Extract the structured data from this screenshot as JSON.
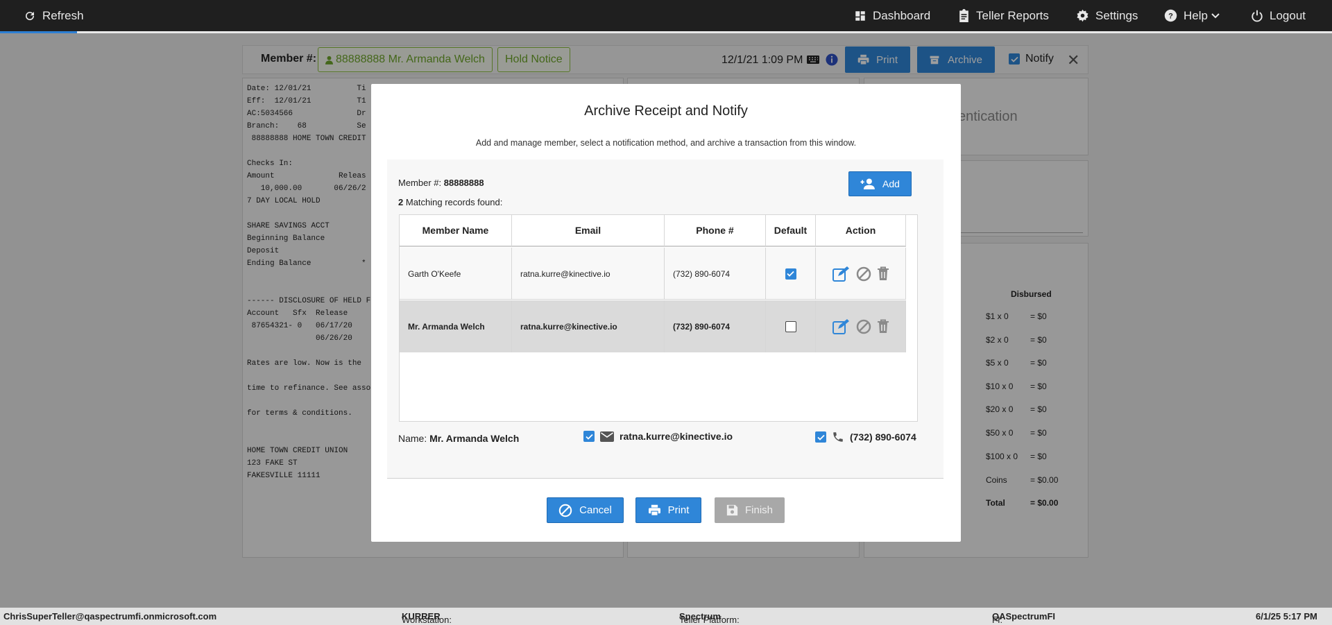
{
  "topbar": {
    "refresh": "Refresh",
    "dashboard": "Dashboard",
    "teller_reports": "Teller Reports",
    "settings": "Settings",
    "help": "Help",
    "logout": "Logout"
  },
  "member_bar": {
    "label": "Member #:",
    "member_chip": "88888888 Mr. Armanda Welch",
    "hold_notice": "Hold Notice",
    "datetime": "12/1/21 1:09 PM",
    "print": "Print",
    "archive": "Archive",
    "notify": "Notify"
  },
  "receipt_lines": "Date: 12/01/21          Ti\nEff:  12/01/21          T1\nAC:5034566              Dr\nBranch:    68           Se\n 88888888 HOME TOWN CREDIT\n\nChecks In:\nAmount              Releas\n   10,000.00       06/26/2\n7 DAY LOCAL HOLD\n\nSHARE SAVINGS ACCT\nBeginning Balance\nDeposit\nEnding Balance           *\n\n\n------ DISCLOSURE OF HELD F\nAccount   Sfx  Release\n 87654321- 0   06/17/20\n               06/26/20\n\nRates are low. Now is the\n\ntime to refinance. See asso\n\nfor terms & conditions.\n\n\nHOME TOWN CREDIT UNION\n123 FAKE ST\nFAKESVILLE 11111",
  "right_panel": {
    "authentication_fragment": "entication",
    "disbursed_title": "Disbursed",
    "rows": [
      {
        "denom": "$1 x 0",
        "amount": "= $0"
      },
      {
        "denom": "$2 x 0",
        "amount": "= $0"
      },
      {
        "denom": "$5 x 0",
        "amount": "= $0"
      },
      {
        "denom": "$10 x 0",
        "amount": "= $0"
      },
      {
        "denom": "$20 x 0",
        "amount": "= $0"
      },
      {
        "denom": "$50 x 0",
        "amount": "= $0"
      },
      {
        "denom": "$100 x 0",
        "amount": "= $0"
      },
      {
        "denom": "Coins",
        "amount": "= $0.00"
      },
      {
        "denom": "Total",
        "amount": "= $0.00"
      }
    ]
  },
  "modal": {
    "title": "Archive Receipt and Notify",
    "subtitle": "Add and manage member, select a notification method, and archive a transaction from this window.",
    "member_label": "Member #:",
    "member_number": "88888888",
    "add_label": "Add",
    "count": "2",
    "count_text": "Matching records found:",
    "columns": [
      "Member Name",
      "Email",
      "Phone #",
      "Default",
      "Action"
    ],
    "rows": [
      {
        "name": "Garth O'Keefe",
        "email": "ratna.kurre@kinective.io",
        "phone": "(732) 890-6074",
        "default": true
      },
      {
        "name": "Mr. Armanda Welch",
        "email": "ratna.kurre@kinective.io",
        "phone": "(732) 890-6074",
        "default": false
      }
    ],
    "summary": {
      "name_label": "Name:",
      "name": "Mr. Armanda Welch",
      "email": "ratna.kurre@kinective.io",
      "phone": "(732) 890-6074"
    },
    "buttons": {
      "cancel": "Cancel",
      "print": "Print",
      "finish": "Finish"
    }
  },
  "statusbar": {
    "user": "ChrisSuperTeller@qaspectrumfi.onmicrosoft.com",
    "workstation_label": "Workstation:",
    "workstation": "KURRER",
    "platform_label": "Teller Platform:",
    "platform": "Spectrum",
    "fi_label": "FI:",
    "fi": "QASpectrumFI",
    "datetime": "6/1/25 5:17 PM"
  },
  "colors": {
    "accent": "#2f86d8",
    "topbar": "#1f1f1f",
    "member_green": "#6ea62a"
  }
}
